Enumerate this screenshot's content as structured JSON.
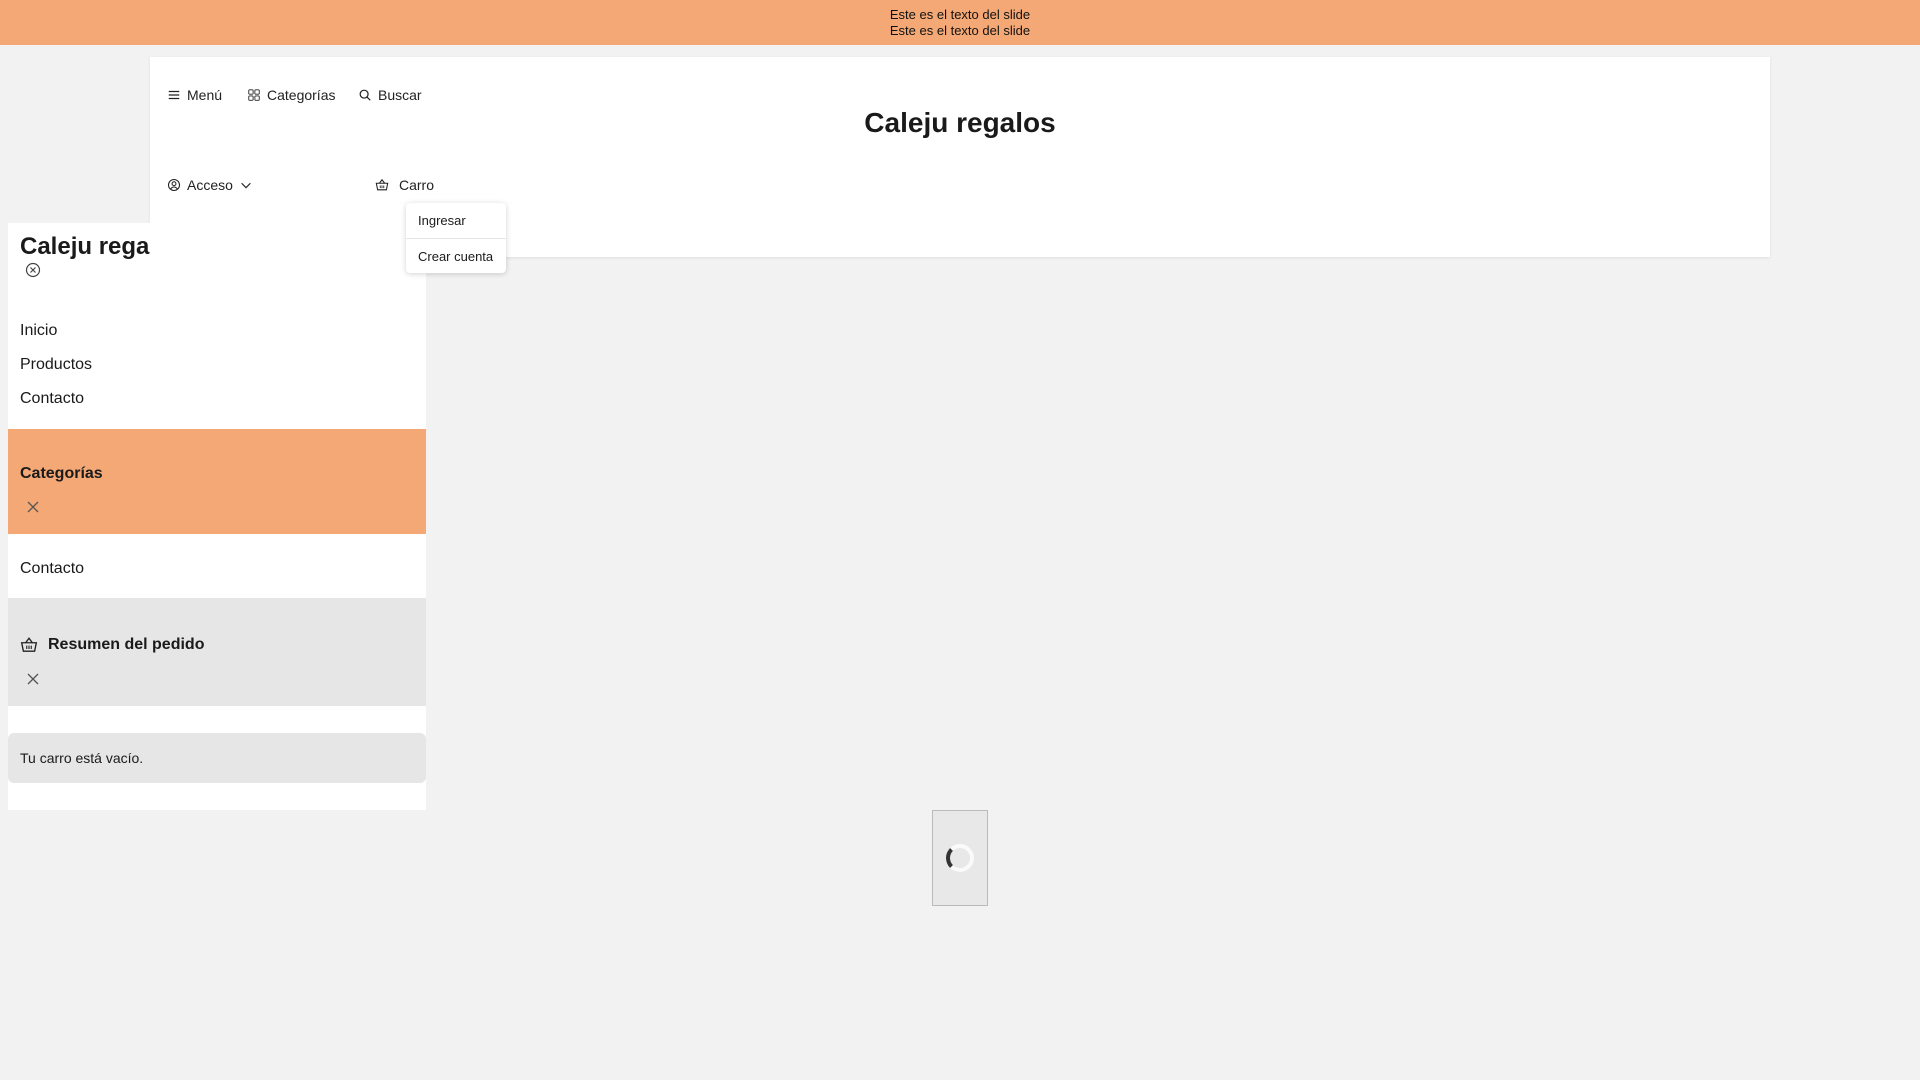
{
  "announcement": {
    "line1": "Este es el texto del slide",
    "line2": "Este es el texto del slide"
  },
  "header": {
    "menu_label": "Menú",
    "categories_label": "Categorías",
    "search_label": "Buscar",
    "brand": "Caleju regalos",
    "access_label": "Acceso",
    "cart_label": "Carro"
  },
  "access_dropdown": {
    "items": [
      "Ingresar",
      "Crear cuenta"
    ]
  },
  "sidebar": {
    "title": "Caleju rega",
    "nav": [
      "Inicio",
      "Productos",
      "Contacto"
    ],
    "categories_title": "Categorías",
    "categories_contact": "Contacto",
    "order_summary_title": "Resumen del pedido",
    "empty_cart": "Tu carro está vacío."
  },
  "colors": {
    "accent": "#f4a875",
    "panel_gray": "#e6e6e6",
    "page_bg": "#f2f2f2"
  },
  "icons": [
    "menu-icon",
    "grid-icon",
    "search-icon",
    "user-circle-icon",
    "chevron-down-icon",
    "basket-icon",
    "close-circle-icon",
    "close-icon"
  ]
}
